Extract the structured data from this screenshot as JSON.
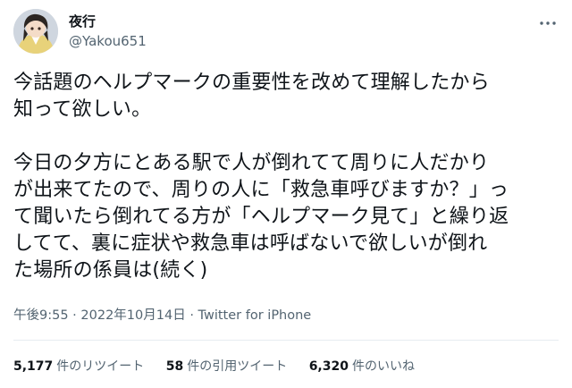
{
  "user": {
    "display_name": "夜行",
    "handle": "@Yakou651",
    "avatar_icon": "user-avatar-icon"
  },
  "tweet": {
    "text": "今話題のヘルプマークの重要性を改めて理解したから\n知って欲しい。\n\n今日の夕方にとある駅で人が倒れてて周りに人だかり\nが出来てたので、周りの人に「救急車呼びますか？」っ\nて聞いたら倒れてる方が「ヘルプマーク見て」と繰り返\nしてて、裏に症状や救急車は呼ばないで欲しいが倒れ\nた場所の係員は(続く)"
  },
  "meta": {
    "time": "午後9:55",
    "separator": "·",
    "date": "2022年10月14日",
    "source": "Twitter for iPhone"
  },
  "stats": {
    "retweets_count": "5,177",
    "retweets_label": "件のリツイート",
    "quotes_count": "58",
    "quotes_label": "件の引用ツイート",
    "likes_count": "6,320",
    "likes_label": "件のいいね"
  },
  "colors": {
    "text": "#0f1419",
    "secondary": "#536471",
    "divider": "#e6ecf0"
  }
}
